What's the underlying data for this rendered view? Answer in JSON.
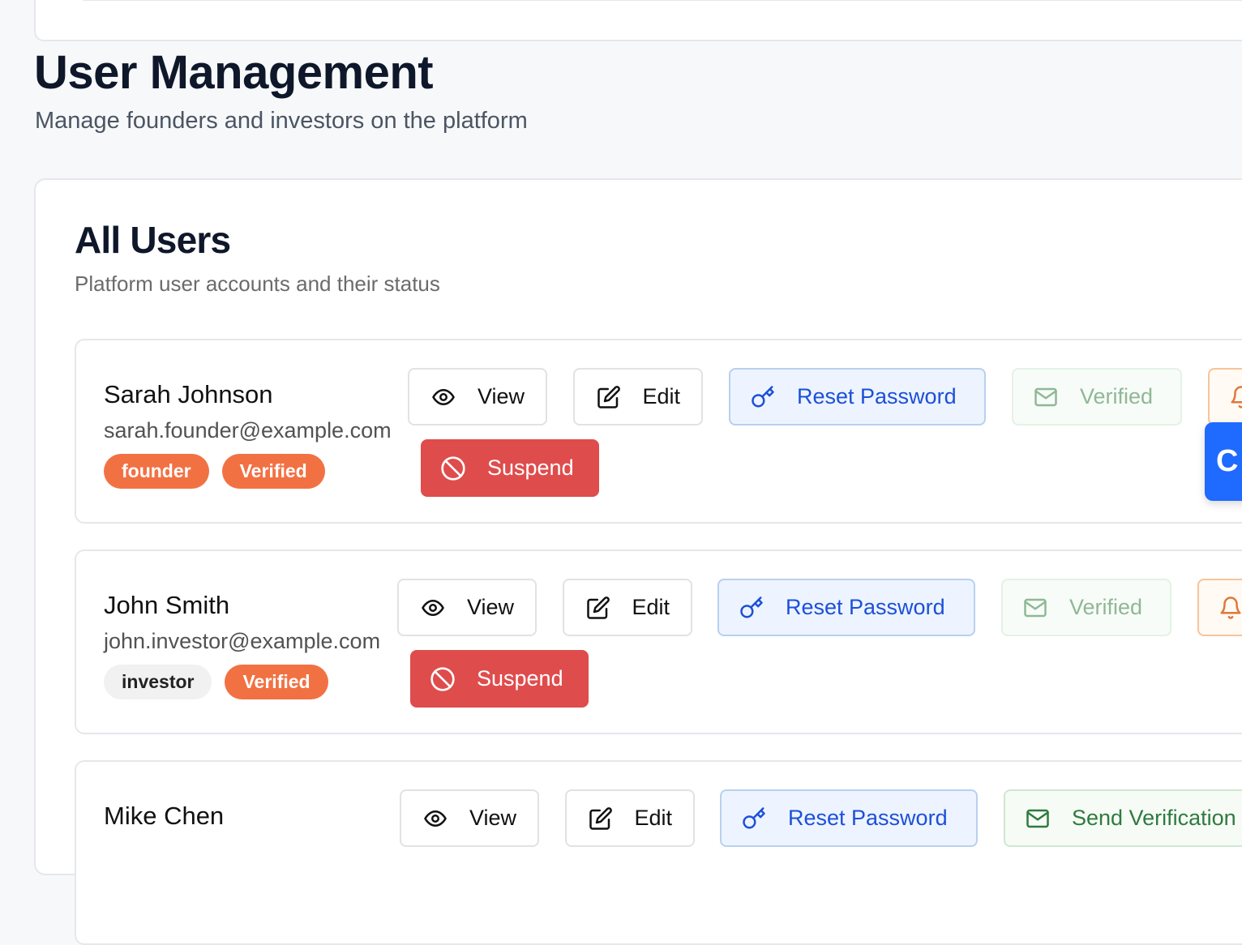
{
  "header": {
    "title": "User Management",
    "subtitle": "Manage founders and investors on the platform"
  },
  "users_card": {
    "title": "All Users",
    "subtitle": "Platform user accounts and their status"
  },
  "actions": {
    "view": "View",
    "edit": "Edit",
    "reset_password": "Reset Password",
    "suspend": "Suspend",
    "verified": "Verified",
    "send_verification": "Send Verification"
  },
  "users": [
    {
      "name": "Sarah Johnson",
      "email": "sarah.founder@example.com",
      "role": "founder",
      "status": "Verified",
      "verification_label": "Verified"
    },
    {
      "name": "John Smith",
      "email": "john.investor@example.com",
      "role": "investor",
      "status": "Verified",
      "verification_label": "Verified"
    },
    {
      "name": "Mike Chen",
      "email": "",
      "role": "",
      "status": "",
      "verification_label": "Send Verification"
    }
  ],
  "floating_widget": {
    "label": "C"
  },
  "icons": {
    "view": "eye-icon",
    "edit": "edit-icon",
    "reset_password": "key-icon",
    "verified": "mail-icon",
    "notify": "bell-icon",
    "suspend": "ban-icon"
  },
  "colors": {
    "accent_orange": "#f27143",
    "danger_red": "#df4c4c",
    "link_blue": "#1d4fd8",
    "fab_blue": "#1f6aff"
  }
}
